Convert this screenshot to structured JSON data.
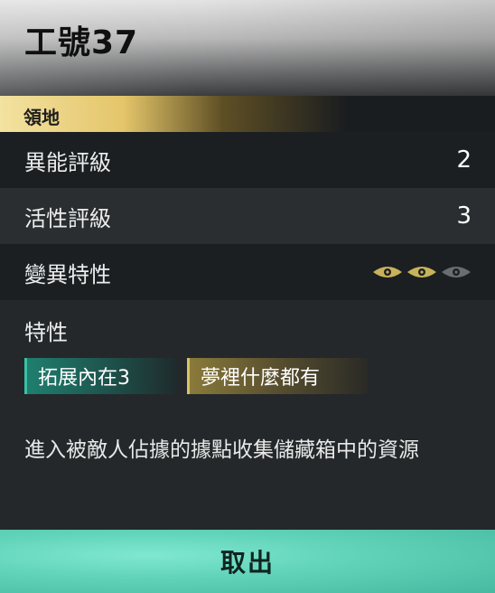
{
  "header": {
    "title": "工號37"
  },
  "section": {
    "label": "領地"
  },
  "stats": [
    {
      "label": "異能評級",
      "value": "2"
    },
    {
      "label": "活性評級",
      "value": "3"
    }
  ],
  "mutation": {
    "label": "變異特性",
    "level": 2,
    "max": 3,
    "active_color": "#c9b25a",
    "inactive_color": "#6a6d70"
  },
  "traits": {
    "title": "特性",
    "tags": [
      {
        "label": "拓展內在3",
        "accent": "#39c2a6"
      },
      {
        "label": "夢裡什麼都有",
        "accent": "#d9c265"
      }
    ],
    "description": "進入被敵人佔據的據點收集儲藏箱中的資源"
  },
  "actions": {
    "primary": "取出"
  }
}
